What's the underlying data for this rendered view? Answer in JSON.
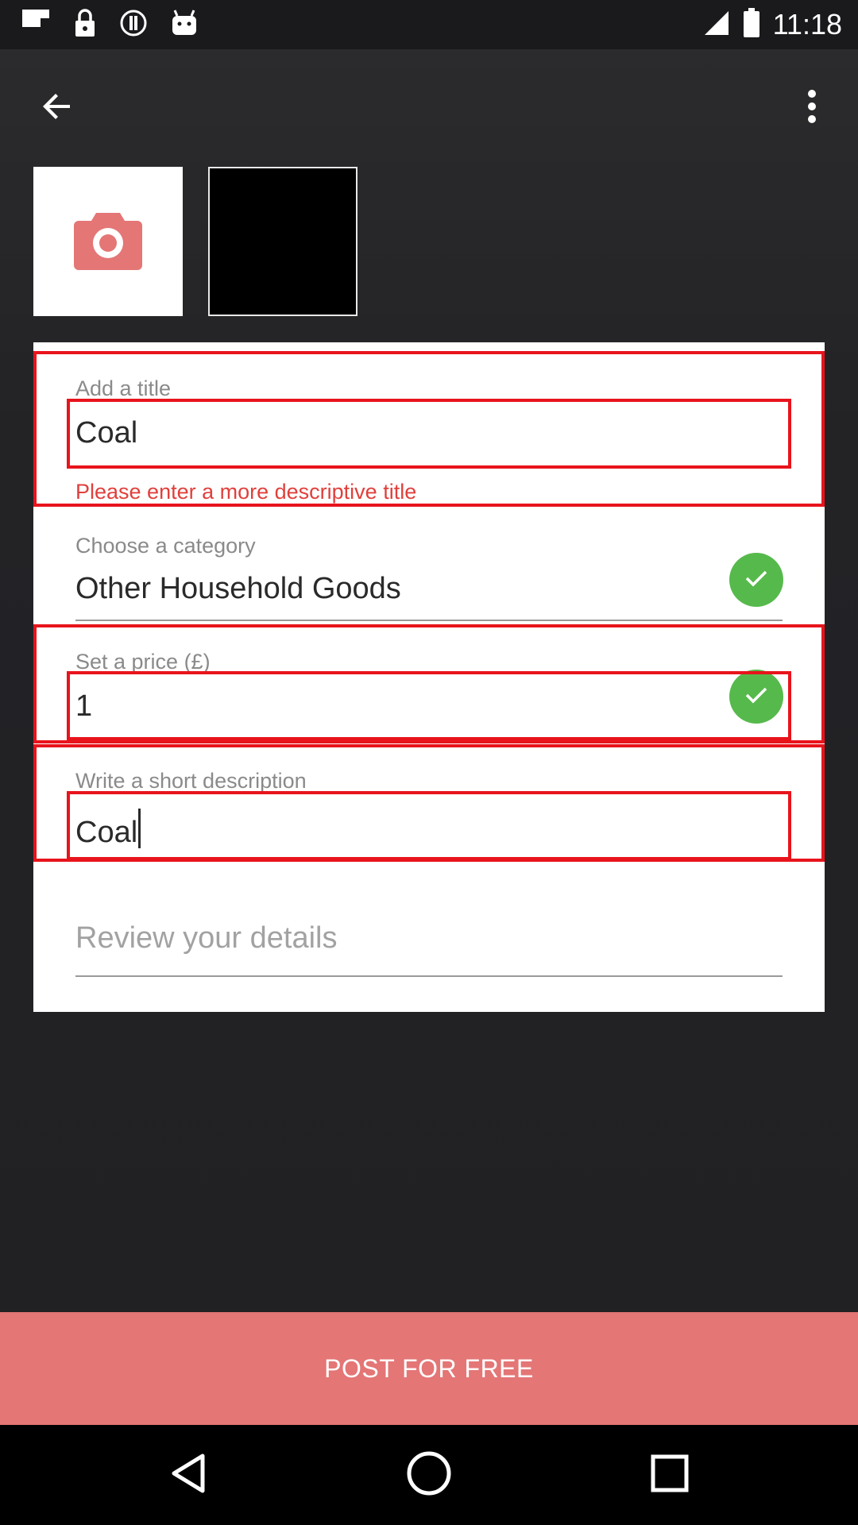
{
  "status_bar": {
    "time": "11:18",
    "left_icons": [
      "flipboard-icon",
      "lock-icon",
      "info-icon",
      "android-icon"
    ],
    "right_icons": [
      "signal-icon",
      "battery-icon"
    ]
  },
  "toolbar": {
    "back_icon": "arrow-left-icon",
    "more_icon": "more-vert-icon"
  },
  "photos": {
    "add_photo_icon": "camera-icon",
    "accent_color": "#e47676"
  },
  "form": {
    "title": {
      "label": "Add a title",
      "value": "Coal",
      "error": "Please enter a more descriptive title"
    },
    "category": {
      "label": "Choose a category",
      "value": "Other Household Goods"
    },
    "price": {
      "label": "Set a price (£)",
      "value": "1"
    },
    "description": {
      "label": "Write a short description",
      "value": "Coal"
    },
    "review": {
      "placeholder": "Review your details"
    }
  },
  "post_button": {
    "label": "POST FOR FREE",
    "color": "#e47676"
  },
  "colors": {
    "error": "#e0403c",
    "valid": "#56b94c",
    "highlight": "#e8141c"
  },
  "nav_bar": {
    "icons": [
      "back-triangle-icon",
      "home-circle-icon",
      "recents-square-icon"
    ]
  }
}
